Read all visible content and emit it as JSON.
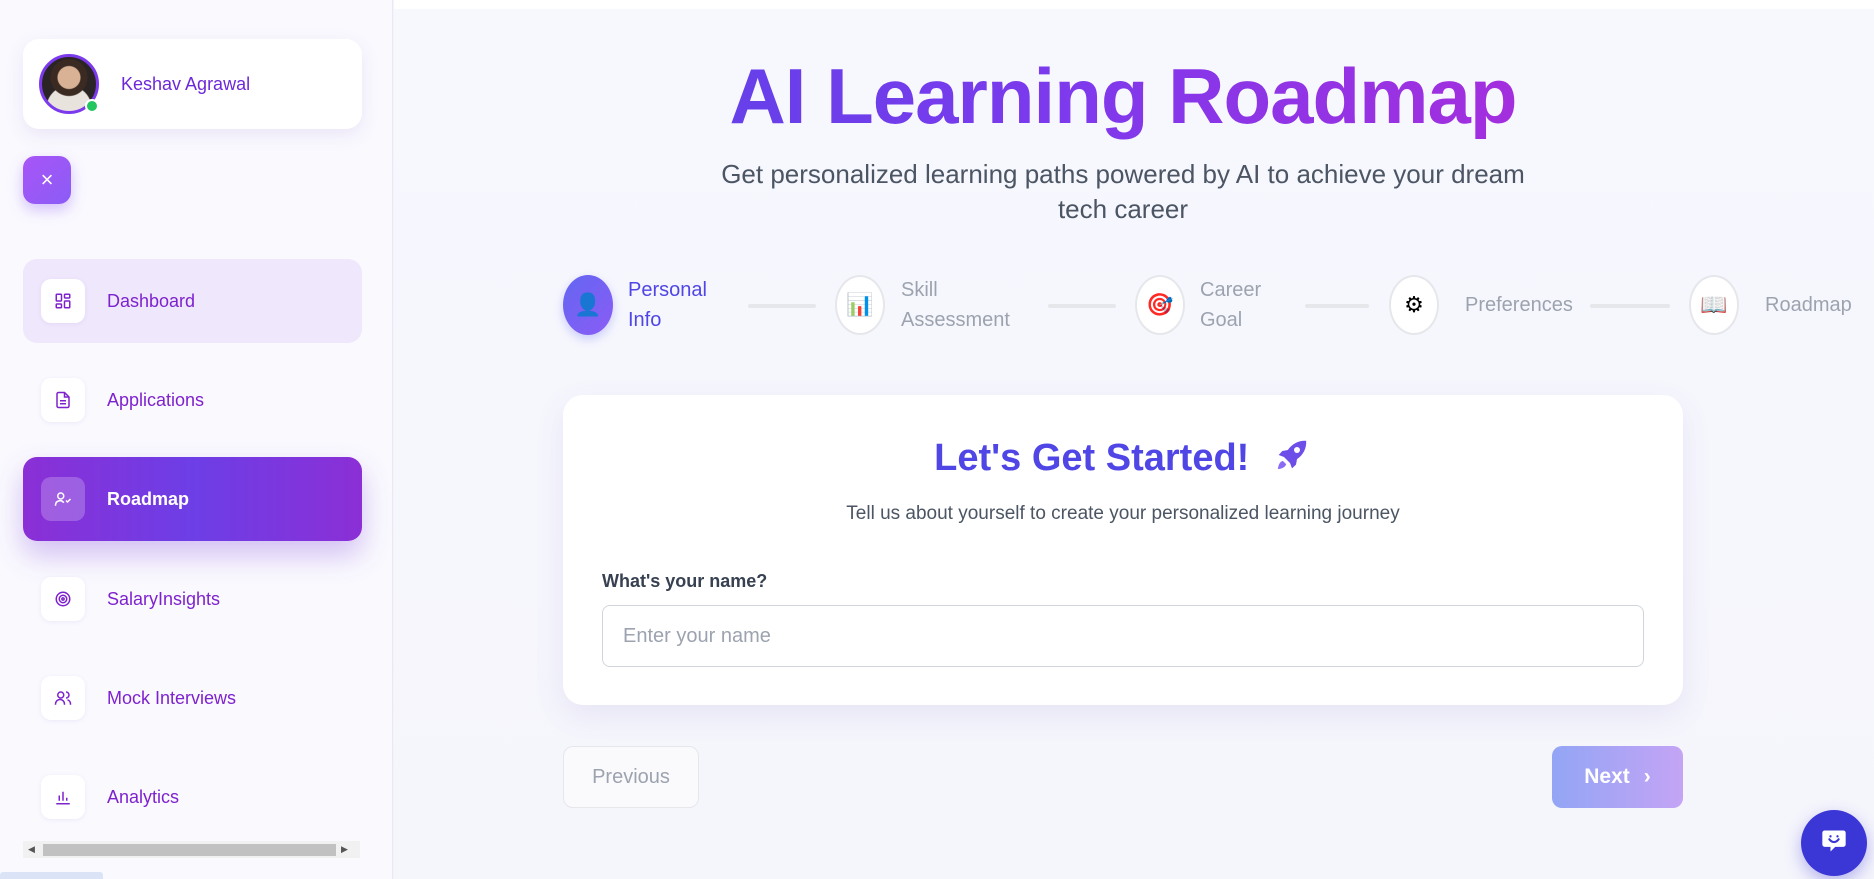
{
  "sidebar": {
    "user_name": "Keshav Agrawal",
    "close_icon": "×",
    "items": [
      {
        "label": "Dashboard",
        "icon": "dashboard-icon"
      },
      {
        "label": "Applications",
        "icon": "document-icon"
      },
      {
        "label": "Roadmap",
        "icon": "user-check-icon"
      },
      {
        "label": "SalaryInsights",
        "icon": "target-icon"
      },
      {
        "label": "Mock Interviews",
        "icon": "users-icon"
      },
      {
        "label": "Analytics",
        "icon": "bar-chart-icon"
      }
    ],
    "active_item": "Roadmap"
  },
  "header": {
    "title": "AI Learning Roadmap",
    "subtitle": "Get personalized learning paths powered by AI to achieve your dream tech career"
  },
  "steps": [
    {
      "line1": "Personal",
      "line2": "Info",
      "icon": "👤",
      "active": true
    },
    {
      "line1": "Skill",
      "line2": "Assessment",
      "icon": "📊",
      "active": false
    },
    {
      "line1": "Career",
      "line2": "Goal",
      "icon": "🎯",
      "active": false
    },
    {
      "line1": "Preferences",
      "line2": "",
      "icon": "⚙",
      "active": false
    },
    {
      "line1": "Roadmap",
      "line2": "",
      "icon": "📖",
      "active": false
    }
  ],
  "form": {
    "title": "Let's Get Started!",
    "description": "Tell us about yourself to create your personalized learning journey",
    "name_label": "What's your name?",
    "name_placeholder": "Enter your name",
    "name_value": ""
  },
  "nav_buttons": {
    "previous": "Previous",
    "next": "Next",
    "next_arrow": "›"
  },
  "colors": {
    "accent": "#4f46e5",
    "accent_purple": "#7c3aed",
    "status_online": "#22c55e"
  }
}
